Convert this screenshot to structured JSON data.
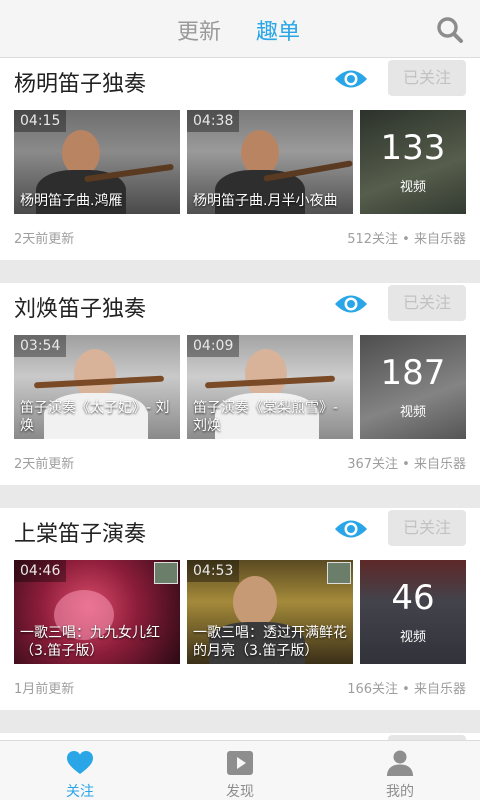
{
  "header": {
    "tabs": [
      {
        "label": "更新",
        "active": false
      },
      {
        "label": "趣单",
        "active": true
      }
    ],
    "search_icon": "search-icon"
  },
  "feed": [
    {
      "title": "杨明笛子独奏",
      "follow_label": "已关注",
      "videos": [
        {
          "duration": "04:15",
          "caption": "杨明笛子曲.鸿雁"
        },
        {
          "duration": "04:38",
          "caption": "杨明笛子曲.月半小夜曲"
        }
      ],
      "more_count": "133",
      "more_label": "视频",
      "updated": "2天前更新",
      "followers": "512关注",
      "source": "来自乐器"
    },
    {
      "title": "刘焕笛子独奏",
      "follow_label": "已关注",
      "videos": [
        {
          "duration": "03:54",
          "caption": "笛子演奏《太子妃》- 刘焕"
        },
        {
          "duration": "04:09",
          "caption": "笛子演奏《棠梨煎雪》- 刘焕"
        }
      ],
      "more_count": "187",
      "more_label": "视频",
      "updated": "2天前更新",
      "followers": "367关注",
      "source": "来自乐器"
    },
    {
      "title": "上棠笛子演奏",
      "follow_label": "已关注",
      "videos": [
        {
          "duration": "04:46",
          "caption": "一歌三唱：九九女儿红（3.笛子版）"
        },
        {
          "duration": "04:53",
          "caption": "一歌三唱：透过开满鲜花的月亮（3.笛子版）"
        }
      ],
      "more_count": "46",
      "more_label": "视频",
      "updated": "1月前更新",
      "followers": "166关注",
      "source": "来自乐器"
    }
  ],
  "bottom_nav": [
    {
      "label": "关注",
      "icon": "heart-icon",
      "active": true
    },
    {
      "label": "发现",
      "icon": "play-icon",
      "active": false
    },
    {
      "label": "我的",
      "icon": "user-icon",
      "active": false
    }
  ],
  "colors": {
    "accent": "#2aa6e8",
    "follow_bg": "#e6e6e6",
    "page_bg": "#e9e9e9"
  }
}
